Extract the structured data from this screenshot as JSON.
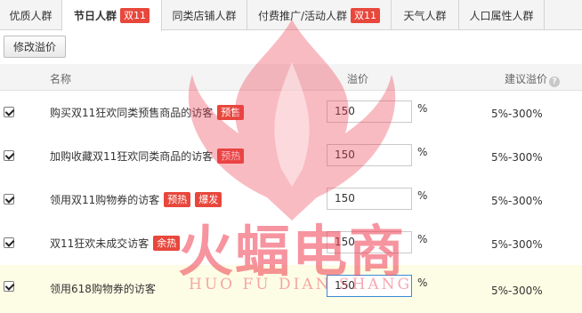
{
  "tabs": [
    {
      "label": "优质人群",
      "badge": "",
      "active": false
    },
    {
      "label": "节日人群",
      "badge": "双11",
      "active": true
    },
    {
      "label": "同类店铺人群",
      "badge": "",
      "active": false
    },
    {
      "label": "付费推广/活动人群",
      "badge": "双11",
      "active": false
    },
    {
      "label": "天气人群",
      "badge": "",
      "active": false
    },
    {
      "label": "人口属性人群",
      "badge": "",
      "active": false
    }
  ],
  "toolbar": {
    "edit_label": "修改溢价"
  },
  "table": {
    "headers": {
      "name": "名称",
      "price": "溢价",
      "suggest": "建议溢价",
      "help_glyph": "?"
    },
    "rows": [
      {
        "checked": true,
        "name": "购买双11狂欢同类预售商品的访客",
        "tags": [
          "预售"
        ],
        "value": "150",
        "unit": "%",
        "suggest": "5%-300%"
      },
      {
        "checked": true,
        "name": "加购收藏双11狂欢同类商品的访客",
        "tags": [
          "预热"
        ],
        "value": "150",
        "unit": "%",
        "suggest": "5%-300%"
      },
      {
        "checked": true,
        "name": "领用双11购物券的访客",
        "tags": [
          "预热",
          "爆发"
        ],
        "value": "150",
        "unit": "%",
        "suggest": "5%-300%"
      },
      {
        "checked": true,
        "name": "双11狂欢未成交访客",
        "tags": [
          "余热"
        ],
        "value": "150",
        "unit": "%",
        "suggest": "5%-300%"
      },
      {
        "checked": true,
        "name": "领用618购物券的访客",
        "tags": [],
        "value": "150",
        "unit": "%",
        "suggest": "5%-300%"
      }
    ]
  },
  "watermark": {
    "cn": "火蝠电商",
    "en": "HUO FU DIAN SHANG",
    "color": "#ee3c50"
  },
  "colors": {
    "tag": "#e8473c",
    "focus": "#3b8bd6",
    "highlight_row": "#fdfde5"
  }
}
